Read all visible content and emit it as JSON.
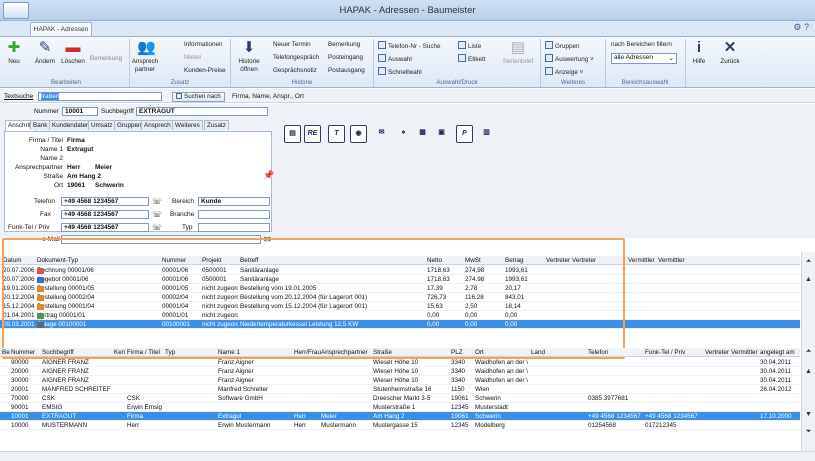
{
  "window": {
    "title": "HAPAK - Adressen - Baumeister",
    "tab": "HAPAK - Adressen",
    "controls": "⚙ ?"
  },
  "ribbon": {
    "bearbeiten": {
      "group": "Bearbeiten",
      "neu": "Neu",
      "aendern": "Ändern",
      "loeschen": "Löschen",
      "bemerkung": "Bemerkung"
    },
    "zusatz": {
      "group": "Zusatz",
      "ansprechpartner": "Ansprech partner",
      "informationen": "Informationen",
      "mieter": "Mieter",
      "kunden_preise": "Kunden-Preise"
    },
    "historie": {
      "group": "Historie",
      "historie_oeffnen": "Historie öffnen",
      "neuer_termin": "Neuer Termin",
      "telefongespraech": "Telefongespräch",
      "gespraechsnotiz": "Gesprächsnotiz",
      "bemerkung": "Bemerkung",
      "posteingang": "Posteingang",
      "postausgang": "Postausgang"
    },
    "auswahl": {
      "group": "Auswahl/Druck",
      "telefon_suche": "Telefon-Nr - Suche",
      "auswahl": "Auswahl",
      "schnellwahl": "Schnellwahl",
      "liste": "Liste",
      "etikett": "Etikett",
      "serienbrief": "Serienbrief"
    },
    "weiteres": {
      "group": "Weiteres",
      "gruppen": "Gruppen",
      "auswertung": "Auswertung ˅",
      "anzeige": "Anzeige ˅"
    },
    "bereich": {
      "group": "Bereichsauswahl",
      "filter_label": "nach Bereichen filtern",
      "select_value": "alle Adressen"
    },
    "hilfe": "Hilfe",
    "zurueck": "Zurück"
  },
  "search": {
    "label": "Textsuche",
    "value": "traben",
    "button": "Suchen nach",
    "fields": "Firma, Name, Anspr., Ort"
  },
  "record": {
    "nummer_label": "Nummer",
    "nummer": "10001",
    "suchbegriff_label": "Suchbegriff",
    "suchbegriff": "EXTRAGUT"
  },
  "form_tabs": [
    "Anschrift",
    "Bank",
    "Kundendaten",
    "Umsatz",
    "Gruppen",
    "Ansprech",
    "Weiteres",
    "Zusatz"
  ],
  "address": {
    "firma_titel": {
      "label": "Firma / Titel",
      "value": "Firma"
    },
    "name1": {
      "label": "Name 1",
      "value": "Extragut"
    },
    "name2": {
      "label": "Name 2",
      "value": ""
    },
    "ansprechpartner": {
      "label": "Ansprechpartner",
      "anrede": "Herr",
      "name": "Meier"
    },
    "strasse": {
      "label": "Straße",
      "value": "Am Hang 2"
    },
    "ort": {
      "label": "Ort",
      "plz": "19061",
      "value": "Schwerin"
    }
  },
  "contact": {
    "telefon": {
      "label": "Telefon",
      "value": "+49 4568 1234567"
    },
    "fax": {
      "label": "Fax",
      "value": "+49 4568 1234567"
    },
    "funk": {
      "label": "Funk-Tel / Priv",
      "value": "+49 4568 1234567"
    },
    "email": {
      "label": "e-Mail",
      "value": ""
    },
    "bereich": {
      "label": "Bereich",
      "value": "Kunde"
    },
    "branche": {
      "label": "Branche",
      "value": ""
    },
    "typ": {
      "label": "Typ",
      "value": ""
    }
  },
  "doc_buttons": [
    "RE",
    "T",
    "P"
  ],
  "documents": {
    "headers": [
      "Datum",
      "Dokument-Typ",
      "Nummer",
      "Projekt",
      "Betreff",
      "Netto",
      "MwSt",
      "Betrag",
      "Vertreter",
      "Vertreter",
      "Vermittler",
      "Vermittler"
    ],
    "rows": [
      {
        "datum": "20.07.2006",
        "typ": "Rechnung 00001/06",
        "nummer": "00001/06",
        "projekt": "0500001",
        "betreff": "Sanitäranlage",
        "netto": "1718,63",
        "mwst": "274,98",
        "betrag": "1993,61",
        "color": "#d9534f"
      },
      {
        "datum": "20.07.2006",
        "typ": "Angebot 00001/06",
        "nummer": "00001/06",
        "projekt": "0500001",
        "betreff": "Sanitäranlage",
        "netto": "1718,63",
        "mwst": "274,98",
        "betrag": "1993,61",
        "color": "#3c6fc4"
      },
      {
        "datum": "19.01.2005",
        "typ": "Bestellung 00001/05",
        "nummer": "00001/05",
        "projekt": "nicht zugeorc",
        "betreff": "Bestellung vom 19.01.2005",
        "netto": "17,39",
        "mwst": "2,78",
        "betrag": "20,17",
        "color": "#e08a2e"
      },
      {
        "datum": "20.12.2004",
        "typ": "Bestellung 00002/04",
        "nummer": "00002/04",
        "projekt": "nicht zugeorc",
        "betreff": "Bestellung vom 20.12.2004 (für Lagerort 001)",
        "netto": "726,73",
        "mwst": "116,28",
        "betrag": "843,01",
        "color": "#e08a2e"
      },
      {
        "datum": "15.12.2004",
        "typ": "Bestellung 00001/04",
        "nummer": "00001/04",
        "projekt": "nicht zugeorc",
        "betreff": "Bestellung vom 15.12.2004 (für Lagerort 001)",
        "netto": "15,63",
        "mwst": "2,50",
        "betrag": "18,14",
        "color": "#e08a2e"
      },
      {
        "datum": "01.04.2001",
        "typ": "Vertrag 00001/01",
        "nummer": "00001/01",
        "projekt": "nicht zugeorc",
        "betreff": "",
        "netto": "0,00",
        "mwst": "0,00",
        "betrag": "0,00",
        "color": "#4a9a4a"
      },
      {
        "datum": "09.03.2001",
        "typ": "Anlage 00100001",
        "nummer": "00100001",
        "projekt": "nicht zugeorc",
        "betreff": "Niedertemperaturkessel Leistung 12,5 KW",
        "netto": "0,00",
        "mwst": "0,00",
        "betrag": "0,00",
        "color": "#666",
        "selected": true
      }
    ]
  },
  "addresses": {
    "headers": [
      "Be",
      "Nummer",
      "Suchbegriff",
      "Ken",
      "Firma / Titel",
      "Typ",
      "Name 1",
      "Herr/Frau",
      "Ansprechpartner",
      "Straße",
      "PLZ",
      "Ort",
      "Land",
      "Telefon",
      "Funk-Tel / Priv",
      "Vertreter",
      "Vermittler",
      "angelegt am"
    ],
    "rows": [
      {
        "be": "P",
        "be_color": "#e08a2e",
        "nummer": "90000",
        "such": "AIGNER FRANZ",
        "firma": "",
        "name1": "Franz Aigner",
        "herr": "",
        "ansp": "",
        "strasse": "Wieser Höhe 10",
        "plz": "3340",
        "ort": "Waidhofen an der \\",
        "tel": "",
        "funk": "",
        "angelegt": "30.04.2011"
      },
      {
        "be": "K",
        "be_color": "#3c6fc4",
        "nummer": "20000",
        "such": "AIGNER FRANZ",
        "firma": "",
        "name1": "Franz Aigner",
        "herr": "",
        "ansp": "",
        "strasse": "Wieser Höhe 10",
        "plz": "3340",
        "ort": "Waidhofen an der \\",
        "tel": "",
        "funk": "",
        "angelegt": "30.04.2011"
      },
      {
        "be": "L",
        "be_color": "#4a9a4a",
        "nummer": "30000",
        "such": "AIGNER FRANZ",
        "firma": "",
        "name1": "Franz Aigner",
        "herr": "",
        "ansp": "",
        "strasse": "Wieser Höhe 10",
        "plz": "3340",
        "ort": "Waidhofen an der \\",
        "tel": "",
        "funk": "",
        "angelegt": "30.04.2011"
      },
      {
        "be": "K",
        "be_color": "#3c6fc4",
        "nummer": "20001",
        "such": "MANFRED SCHREITEF",
        "firma": "",
        "name1": "Manfred Schreiter",
        "herr": "",
        "ansp": "",
        "strasse": "Stutenheimstraße 16",
        "plz": "1150",
        "ort": "Wien",
        "tel": "",
        "funk": "",
        "angelegt": "26.04.2012"
      },
      {
        "be": "L",
        "be_color": "#4a9a4a",
        "nummer": "70000",
        "such": "CSK",
        "firma": "CSK",
        "name1": "Software GmbH",
        "herr": "",
        "ansp": "",
        "strasse": "Dreescher Markt 3-5",
        "plz": "19061",
        "ort": "Schwerin",
        "tel": "0385 3977681",
        "funk": "",
        "angelegt": ""
      },
      {
        "be": "P",
        "be_color": "#e08a2e",
        "nummer": "90001",
        "such": "EMSIG",
        "firma": "Erwin Emsig",
        "name1": "",
        "herr": "",
        "ansp": "",
        "strasse": "Musterstraße 1",
        "plz": "12345",
        "ort": "Musterstadt",
        "tel": "",
        "funk": "",
        "angelegt": ""
      },
      {
        "be": "K",
        "be_color": "#3c6fc4",
        "nummer": "10001",
        "such": "EXTRAGUT",
        "firma": "Firma",
        "name1": "Extragut",
        "herr": "Herr",
        "ansp": "Meier",
        "strasse": "Am Hang 2",
        "plz": "19061",
        "ort": "Schwerin",
        "tel": "+49 4568 1234567",
        "funk": "+49 4568 1234567",
        "angelegt": "17.10.2000",
        "selected": true
      },
      {
        "be": "K",
        "be_color": "#3c6fc4",
        "nummer": "10000",
        "such": "MUSTERMANN",
        "firma": "Herr",
        "name1": "Erwin Mustermann",
        "herr": "Herr",
        "ansp": "Mustermann",
        "strasse": "Mustergasse 15",
        "plz": "12345",
        "ort": "Modelberg",
        "tel": "01254568",
        "funk": "017212345",
        "angelegt": ""
      }
    ]
  },
  "side_arrows": {
    "top": "⏶",
    "up": "▲",
    "down": "▼",
    "bottom": "⏷"
  }
}
